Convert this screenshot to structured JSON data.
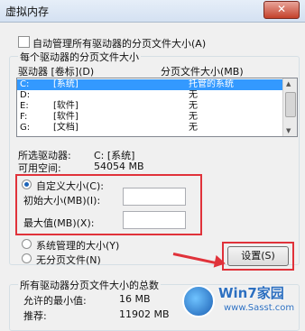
{
  "window": {
    "title": "虚拟内存",
    "close_label": "✕"
  },
  "auto_manage": {
    "label": "自动管理所有驱动器的分页文件大小(A)",
    "checked": false
  },
  "per_drive": {
    "group_label": "每个驱动器的分页文件大小",
    "col_drive": "驱动器 [卷标](D)",
    "col_size": "分页文件大小(MB)",
    "rows": [
      {
        "drive": "C:",
        "label": "[系统]",
        "size": "托管的系统",
        "selected": true
      },
      {
        "drive": "D:",
        "label": "",
        "size": "无",
        "selected": false
      },
      {
        "drive": "E:",
        "label": "[软件]",
        "size": "无",
        "selected": false
      },
      {
        "drive": "F:",
        "label": "[软件]",
        "size": "无",
        "selected": false
      },
      {
        "drive": "G:",
        "label": "[文档]",
        "size": "无",
        "selected": false
      }
    ]
  },
  "selected_drive": {
    "label": "所选驱动器:",
    "value": "C:  [系统]",
    "free_label": "可用空间:",
    "free_value": "54054 MB"
  },
  "custom_size": {
    "label": "自定义大小(C):",
    "initial_label": "初始大小(MB)(I):",
    "initial_value": "",
    "max_label": "最大值(MB)(X):",
    "max_value": "",
    "checked": true
  },
  "system_managed": {
    "label": "系统管理的大小(Y)",
    "checked": false
  },
  "no_paging": {
    "label": "无分页文件(N)",
    "checked": false
  },
  "set_button": "设置(S)",
  "total": {
    "group_label": "所有驱动器分页文件大小的总数",
    "min_label": "允许的最小值:",
    "min_value": "16 MB",
    "rec_label": "推荐:",
    "rec_value": "11902 MB"
  },
  "watermark": {
    "brand": "Win7家园",
    "url": "www.Sasst.com"
  },
  "colors": {
    "highlight": "#e0323a",
    "selection": "#3399ff"
  }
}
